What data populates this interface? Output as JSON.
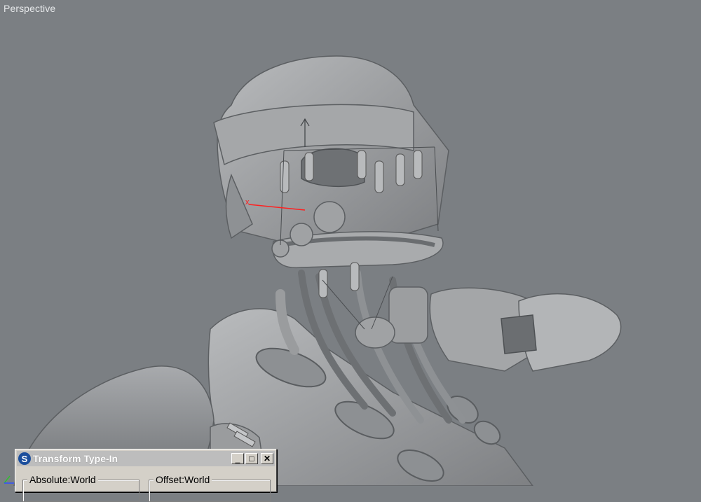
{
  "viewport": {
    "label": "Perspective",
    "gizmo_axis_label": "x"
  },
  "dialog": {
    "title": "Transform Type-In",
    "icon_glyph": "S",
    "minimize_glyph": "_",
    "maximize_glyph": "□",
    "close_glyph": "✕",
    "absolute_group_label": "Absolute:World",
    "offset_group_label": "Offset:World"
  },
  "colors": {
    "viewport_bg": "#7b7f83",
    "model_fill": "#9a9c9e",
    "gizmo_x_axis": "#ff2020"
  }
}
